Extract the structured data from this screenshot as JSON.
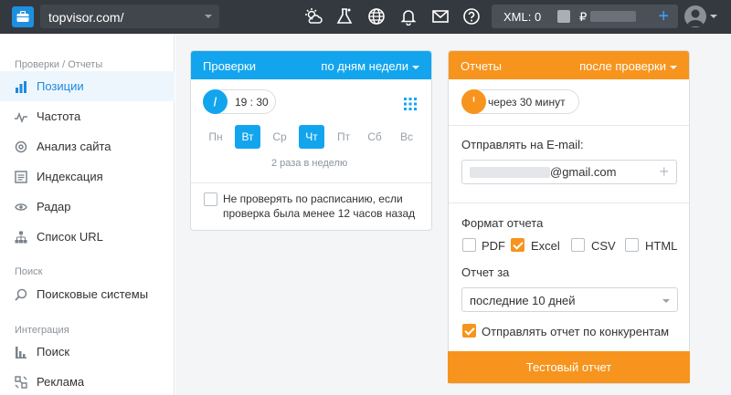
{
  "topbar": {
    "project_name": "topvisor.com/",
    "xml_label": "XML: 0",
    "currency_symbol": "₽",
    "icons": [
      "weather-icon",
      "flask-icon",
      "globe-icon",
      "bell-icon",
      "mail-icon",
      "help-icon"
    ]
  },
  "sidebar": {
    "sections": [
      {
        "title": "Проверки / Отчеты"
      },
      {
        "title": "Поиск"
      },
      {
        "title": "Интеграция"
      }
    ],
    "items": [
      {
        "label": "Позиции",
        "icon": "bar-chart-icon",
        "active": true
      },
      {
        "label": "Частота",
        "icon": "pulse-icon",
        "active": false
      },
      {
        "label": "Анализ сайта",
        "icon": "gear-analysis-icon",
        "active": false
      },
      {
        "label": "Индексация",
        "icon": "index-list-icon",
        "active": false
      },
      {
        "label": "Радар",
        "icon": "eye-icon",
        "active": false
      },
      {
        "label": "Список URL",
        "icon": "sitemap-icon",
        "active": false
      },
      {
        "label": "Поисковые системы",
        "icon": "search-icon",
        "active": false
      },
      {
        "label": "Поиск",
        "icon": "chart-icon",
        "active": false
      },
      {
        "label": "Реклама",
        "icon": "ads-icon",
        "active": false
      }
    ]
  },
  "checks": {
    "title": "Проверки",
    "mode": "по дням недели",
    "time": "19 : 30",
    "days": [
      {
        "label": "Пн",
        "selected": false
      },
      {
        "label": "Вт",
        "selected": true
      },
      {
        "label": "Ср",
        "selected": false
      },
      {
        "label": "Чт",
        "selected": true
      },
      {
        "label": "Пт",
        "selected": false
      },
      {
        "label": "Сб",
        "selected": false
      },
      {
        "label": "Вс",
        "selected": false
      }
    ],
    "frequency_note": "2 раза в неделю",
    "skip_line1": "Не проверять по расписанию, если",
    "skip_line2": "проверка была менее 12 часов назад",
    "skip_checked": false,
    "accent": "#12a5ee"
  },
  "reports": {
    "title": "Отчеты",
    "mode": "после проверки",
    "delay": "через 30 минут",
    "email_label": "Отправлять на E-mail:",
    "email_domain": "@gmail.com",
    "format_label": "Формат отчета",
    "formats": [
      {
        "label": "PDF",
        "checked": false
      },
      {
        "label": "Excel",
        "checked": true
      },
      {
        "label": "CSV",
        "checked": false
      },
      {
        "label": "HTML",
        "checked": false
      }
    ],
    "period_label": "Отчет за",
    "period_value": "последние 10 дней",
    "competitors_label": "Отправлять отчет по конкурентам",
    "competitors_checked": true,
    "test_button": "Тестовый отчет",
    "accent": "#f7941d"
  }
}
